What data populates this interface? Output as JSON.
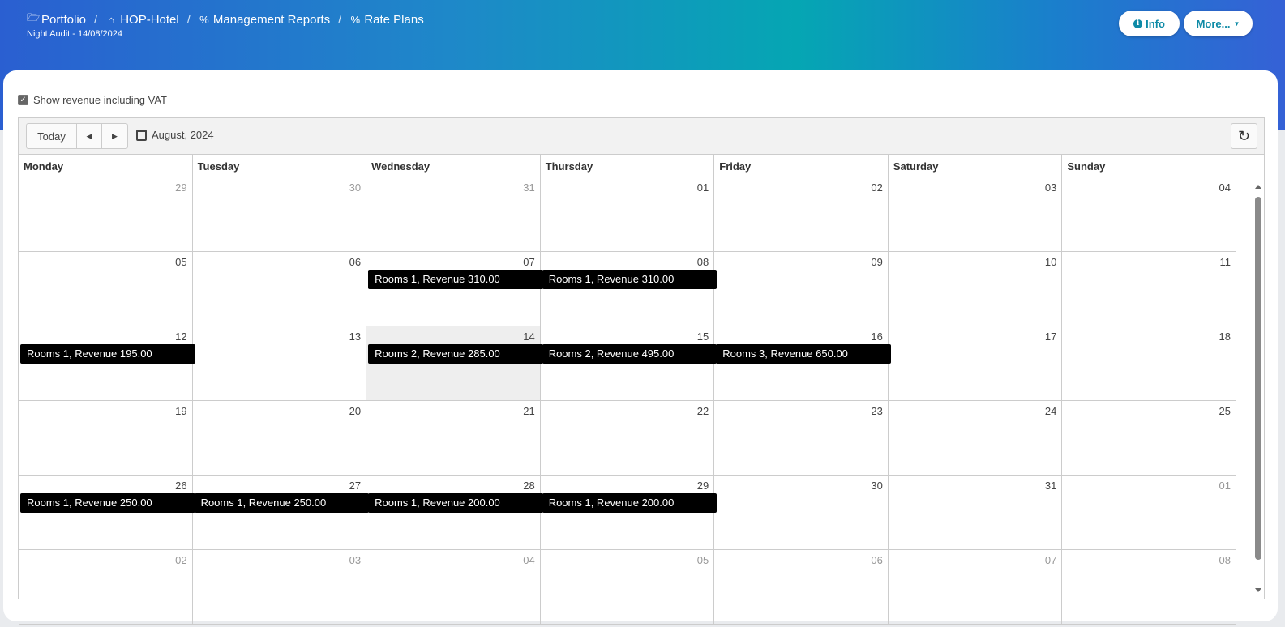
{
  "header": {
    "breadcrumb": [
      {
        "label": "Portfolio",
        "icon": "folder-open-icon"
      },
      {
        "label": "HOP-Hotel",
        "icon": "home-icon"
      },
      {
        "label": "Management Reports",
        "icon": "percent-icon"
      },
      {
        "label": "Rate Plans",
        "icon": "percent-icon"
      }
    ],
    "separator": "/",
    "subtitle": "Night Audit - 14/08/2024",
    "info_label": "Info",
    "more_label": "More..."
  },
  "options": {
    "show_vat_label": "Show revenue including VAT",
    "show_vat_checked": true
  },
  "toolbar": {
    "today_label": "Today",
    "month_label": "August, 2024"
  },
  "calendar": {
    "weekdays": [
      "Monday",
      "Tuesday",
      "Wednesday",
      "Thursday",
      "Friday",
      "Saturday",
      "Sunday"
    ],
    "weeks": [
      [
        {
          "n": "29",
          "other": true
        },
        {
          "n": "30",
          "other": true
        },
        {
          "n": "31",
          "other": true
        },
        {
          "n": "01"
        },
        {
          "n": "02"
        },
        {
          "n": "03"
        },
        {
          "n": "04"
        }
      ],
      [
        {
          "n": "05"
        },
        {
          "n": "06"
        },
        {
          "n": "07",
          "event": "Rooms 1, Revenue 310.00"
        },
        {
          "n": "08",
          "event": "Rooms 1, Revenue 310.00"
        },
        {
          "n": "09"
        },
        {
          "n": "10"
        },
        {
          "n": "11"
        }
      ],
      [
        {
          "n": "12",
          "event": "Rooms 1, Revenue 195.00"
        },
        {
          "n": "13"
        },
        {
          "n": "14",
          "today": true,
          "event": "Rooms 2, Revenue 285.00"
        },
        {
          "n": "15",
          "event": "Rooms 2, Revenue 495.00"
        },
        {
          "n": "16",
          "event": "Rooms 3, Revenue 650.00"
        },
        {
          "n": "17"
        },
        {
          "n": "18"
        }
      ],
      [
        {
          "n": "19"
        },
        {
          "n": "20"
        },
        {
          "n": "21"
        },
        {
          "n": "22"
        },
        {
          "n": "23"
        },
        {
          "n": "24"
        },
        {
          "n": "25"
        }
      ],
      [
        {
          "n": "26",
          "event": "Rooms 1, Revenue 250.00"
        },
        {
          "n": "27",
          "event": "Rooms 1, Revenue 250.00"
        },
        {
          "n": "28",
          "event": "Rooms 1, Revenue 200.00"
        },
        {
          "n": "29",
          "event": "Rooms 1, Revenue 200.00"
        },
        {
          "n": "30"
        },
        {
          "n": "31"
        },
        {
          "n": "01",
          "other": true
        }
      ],
      [
        {
          "n": "02",
          "other": true
        },
        {
          "n": "03",
          "other": true
        },
        {
          "n": "04",
          "other": true
        },
        {
          "n": "05",
          "other": true
        },
        {
          "n": "06",
          "other": true
        },
        {
          "n": "07",
          "other": true
        },
        {
          "n": "08",
          "other": true
        }
      ]
    ]
  }
}
